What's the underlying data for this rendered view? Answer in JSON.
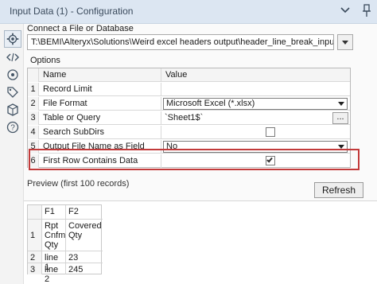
{
  "window": {
    "title": "Input Data (1) - Configuration"
  },
  "icons": {
    "titlebar": [
      "chevron-down-icon",
      "pin-icon"
    ],
    "sidebar": [
      "gear-icon",
      "code-icon",
      "connection-icon",
      "tag-icon",
      "cube-icon",
      "help-icon"
    ]
  },
  "connect": {
    "label": "Connect a File or Database",
    "path": "T:\\BEMI\\Alteryx\\Solutions\\Weird excel headers output\\header_line_break_input.xlsx"
  },
  "options": {
    "label": "Options",
    "headers": [
      "Name",
      "Value"
    ],
    "rows": [
      {
        "num": "1",
        "name": "Record Limit",
        "value": ""
      },
      {
        "num": "2",
        "name": "File Format",
        "value": "Microsoft Excel (*.xlsx)"
      },
      {
        "num": "3",
        "name": "Table or Query",
        "value": "`Sheet1$`",
        "button": "..."
      },
      {
        "num": "4",
        "name": "Search SubDirs",
        "value": "",
        "checked": false
      },
      {
        "num": "5",
        "name": "Output File Name as Field",
        "value": "No"
      },
      {
        "num": "6",
        "name": "First Row Contains Data",
        "value": "",
        "checked": true
      }
    ]
  },
  "preview": {
    "label": "Preview (first 100 records)",
    "refresh_label": "Refresh",
    "headers": [
      "F1",
      "F2"
    ],
    "rows": [
      {
        "num": "1",
        "f1": "Rpt Cnfm Qty",
        "f2": "Covered Qty"
      },
      {
        "num": "2",
        "f1": "line 1",
        "f2": "23"
      },
      {
        "num": "3",
        "f1": "line 2",
        "f2": "245"
      }
    ]
  },
  "colors": {
    "titlebar": "#dce6f2",
    "highlight": "#c23a3a"
  }
}
